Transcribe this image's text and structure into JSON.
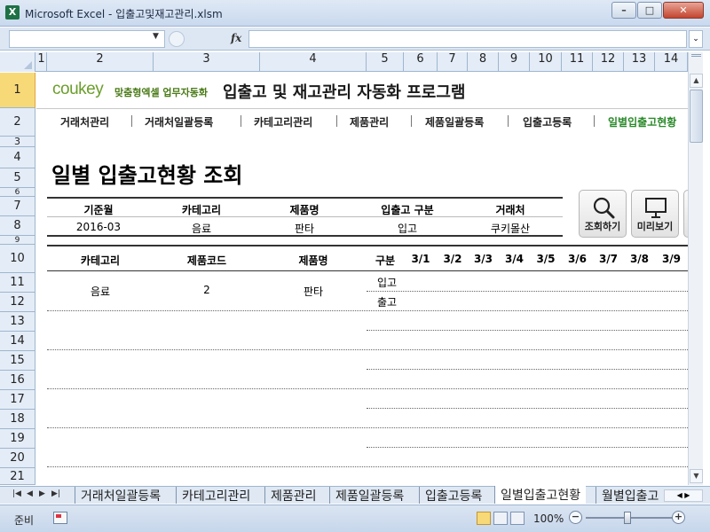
{
  "window": {
    "title": "Microsoft Excel - 입출고및재고관리.xlsm",
    "app_icon": "excel-icon",
    "buttons": {
      "minimize": "–",
      "maximize": "□",
      "close": "✕"
    }
  },
  "formula_bar": {
    "name_box": "",
    "fx_label": "fx",
    "formula": ""
  },
  "columns": [
    "1",
    "2",
    "3",
    "4",
    "5",
    "6",
    "7",
    "8",
    "9",
    "10",
    "11",
    "12",
    "13",
    "14"
  ],
  "rows": [
    "1",
    "2",
    "3",
    "4",
    "5",
    "6",
    "7",
    "8",
    "9",
    "10",
    "11",
    "12",
    "13",
    "14",
    "15",
    "16",
    "17",
    "18",
    "19",
    "20",
    "21"
  ],
  "header": {
    "logo_main": "coukey",
    "logo_tagline": "맞춤형엑셀 업무자동화",
    "program_title": "입출고 및 재고관리 자동화 프로그램"
  },
  "nav": {
    "items": [
      "거래처관리",
      "거래처일괄등록",
      "카테고리관리",
      "제품관리",
      "제품일괄등록",
      "입출고등록",
      "일별입출고현황"
    ],
    "active": "일별입출고현황",
    "active_color": "#2a8a2a"
  },
  "section_title": "일별 입출고현황 조회",
  "criteria": {
    "headers": [
      "기준월",
      "카테고리",
      "제품명",
      "입출고 구분",
      "거래처"
    ],
    "values": [
      "2016-03",
      "음료",
      "판타",
      "입고",
      "쿠키몰산"
    ]
  },
  "buttons": {
    "search": {
      "label": "조회하기",
      "icon": "magnifier-icon"
    },
    "preview": {
      "label": "미리보기",
      "icon": "monitor-icon"
    }
  },
  "grid": {
    "headers": [
      "카테고리",
      "제품코드",
      "제품명",
      "구분",
      "3/1",
      "3/2",
      "3/3",
      "3/4",
      "3/5",
      "3/6",
      "3/7",
      "3/8",
      "3/9"
    ],
    "rows": [
      {
        "category": "음료",
        "code": "2",
        "name": "판타",
        "types": [
          "입고",
          "출고"
        ]
      }
    ]
  },
  "sheet_tabs": {
    "tabs": [
      "거래처일괄등록",
      "카테고리관리",
      "제품관리",
      "제품일괄등록",
      "입출고등록",
      "일별입출고현황",
      "월별입출고"
    ],
    "active": "일별입출고현황"
  },
  "status_bar": {
    "status": "준비",
    "zoom": "100%",
    "zoom_value_percent": 100
  }
}
